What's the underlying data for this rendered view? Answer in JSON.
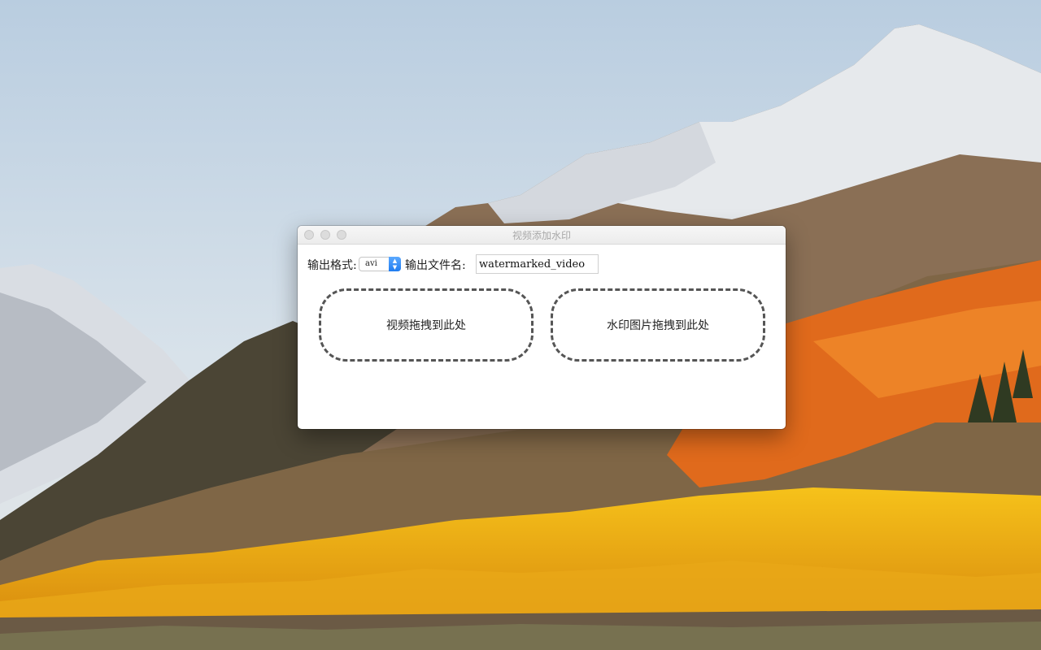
{
  "window": {
    "title": "视频添加水印"
  },
  "toolbar": {
    "format_label": "输出格式:",
    "format_value": "avi",
    "filename_label": "输出文件名:",
    "filename_value": "watermarked_video"
  },
  "drop_zones": {
    "video_label": "视频拖拽到此处",
    "image_label": "水印图片拖拽到此处"
  },
  "icons": {
    "select_arrows": "updown-chevron-icon"
  },
  "colors": {
    "select_accent": "#2f86f5",
    "drop_border": "#555555"
  }
}
